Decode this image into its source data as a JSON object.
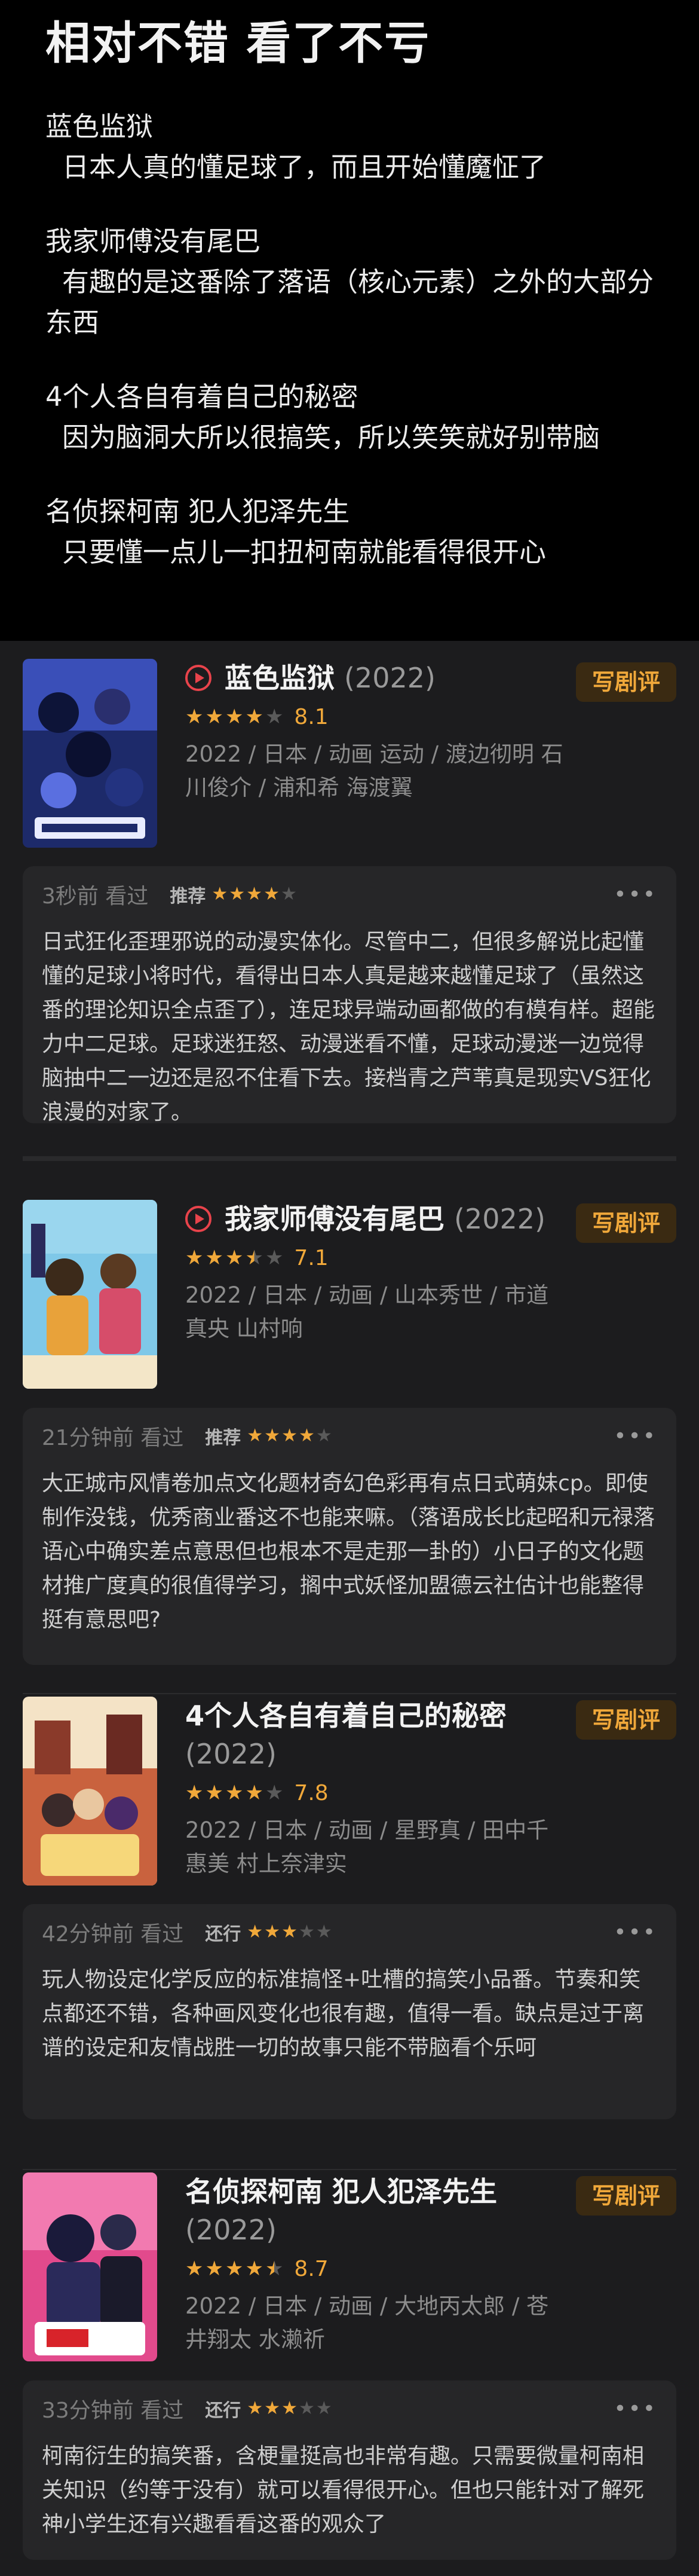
{
  "intro": {
    "title": "相对不错 看了不亏",
    "entries": [
      {
        "title": "蓝色监狱",
        "body": "日本人真的懂足球了，而且开始懂魔怔了"
      },
      {
        "title": "我家师傅没有尾巴",
        "body": "有趣的是这番除了落语（核心元素）之外的大部分东西"
      },
      {
        "title": "4个人各自有着自己的秘密",
        "body": "因为脑洞大所以很搞笑，所以笑笑就好别带脑"
      },
      {
        "title": "名侦探柯南 犯人犯泽先生",
        "body": "只要懂一点儿一扣扭柯南就能看得很开心"
      }
    ]
  },
  "cards": [
    {
      "name": "蓝色监狱",
      "year": "(2022)",
      "has_play_icon": true,
      "stars": 4,
      "score": "8.1",
      "meta": "2022 / 日本 / 动画 运动 / 渡边彻明 石川俊介 / 浦和希 海渡翼",
      "write_label": "写剧评",
      "review": {
        "time": "3秒前 看过",
        "tag": "推荐",
        "stars": 4,
        "more": "•••",
        "text": "日式狂化歪理邪说的动漫实体化。尽管中二，但很多解说比起懂懂的足球小将时代，看得出日本人真是越来越懂足球了（虽然这番的理论知识全点歪了），连足球异端动画都做的有模有样。超能力中二足球。足球迷狂怒、动漫迷看不懂，足球动漫迷一边觉得脑抽中二一边还是忍不住看下去。接档青之芦苇真是现实VS狂化浪漫的对家了。"
      }
    },
    {
      "name": "我家师傅没有尾巴",
      "year": "(2022)",
      "has_play_icon": true,
      "stars": 3.5,
      "score": "7.1",
      "meta": "2022 / 日本 / 动画 / 山本秀世 / 市道真央 山村响",
      "write_label": "写剧评",
      "review": {
        "time": "21分钟前 看过",
        "tag": "推荐",
        "stars": 4,
        "more": "•••",
        "text": "大正城市风情卷加点文化题材奇幻色彩再有点日式萌妹cp。即使制作没钱，优秀商业番这不也能来嘛。（落语成长比起昭和元禄落语心中确实差点意思但也根本不是走那一卦的）小日子的文化题材推广度真的很值得学习，搁中式妖怪加盟德云社估计也能整得挺有意思吧?"
      }
    },
    {
      "name": "4个人各自有着自己的秘密",
      "year": "(2022)",
      "has_play_icon": false,
      "stars": 4,
      "score": "7.8",
      "meta": "2022 / 日本 / 动画 / 星野真 / 田中千惠美 村上奈津实",
      "write_label": "写剧评",
      "review": {
        "time": "42分钟前 看过",
        "tag": "还行",
        "stars": 3,
        "more": "•••",
        "text": "玩人物设定化学反应的标准搞怪+吐槽的搞笑小品番。节奏和笑点都还不错，各种画风变化也很有趣，值得一看。缺点是过于离谱的设定和友情战胜一切的故事只能不带脑看个乐呵"
      }
    },
    {
      "name": "名侦探柯南 犯人犯泽先生",
      "year": "(2022)",
      "has_play_icon": false,
      "stars": 4.5,
      "score": "8.7",
      "meta": "2022 / 日本 / 动画 / 大地丙太郎 / 苍井翔太 水濑祈",
      "write_label": "写剧评",
      "review": {
        "time": "33分钟前 看过",
        "tag": "还行",
        "stars": 3,
        "more": "•••",
        "text": "柯南衍生的搞笑番，含梗量挺高也非常有趣。只需要微量柯南相关知识（约等于没有）就可以看得很开心。但也只能针对了解死神小学生还有兴趣看看这番的观众了"
      }
    }
  ],
  "colors": {
    "star_on": "#f0a83a",
    "star_off": "#5a5a5a",
    "accent": "#f0a83a",
    "play": "#e8434b"
  }
}
